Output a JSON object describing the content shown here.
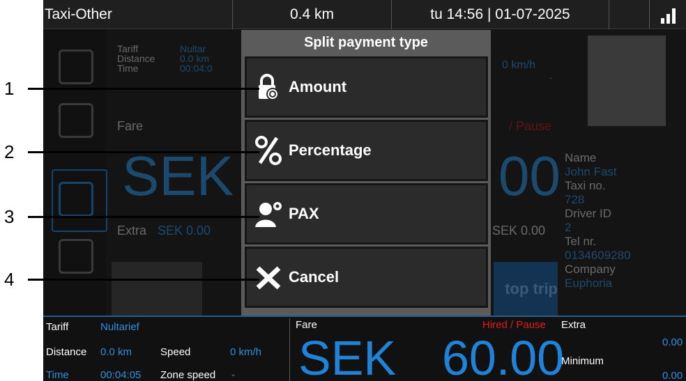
{
  "statusbar": {
    "title": "Taxi-Other",
    "distance": "0.4 km",
    "clock": "tu 14:56 | 01-07-2025"
  },
  "background": {
    "trip": {
      "tariff_label": "Tariff",
      "tariff_value": "Nultar",
      "distance_label": "Distance",
      "distance_value": "0.0 km",
      "time_label": "Time",
      "time_value": "00:04:0",
      "speed_value": "0 km/h",
      "zone_speed_value": "-",
      "fare_label": "Fare",
      "status": "/ Pause",
      "big_currency": "SEK",
      "big_value": "00",
      "extra_label": "Extra",
      "extra_value": "SEK 0.00",
      "extra_value_right": "SEK 0.00",
      "stop_trip": "top trip"
    },
    "profile": {
      "name_label": "Name",
      "name_value": "John Fast",
      "taxi_label": "Taxi no.",
      "taxi_value": "728",
      "driver_label": "Driver ID",
      "driver_value": "2",
      "tel_label": "Tel nr.",
      "tel_value": "0134609280",
      "company_label": "Company",
      "company_value": "Euphoria"
    }
  },
  "dialog": {
    "title": "Split payment type",
    "options": [
      {
        "label": "Amount",
        "icon": "lock-coin-icon"
      },
      {
        "label": "Percentage",
        "icon": "percent-icon"
      },
      {
        "label": "PAX",
        "icon": "passenger-icon"
      },
      {
        "label": "Cancel",
        "icon": "cancel-x-icon"
      }
    ]
  },
  "bottombar": {
    "tariff_label": "Tariff",
    "tariff_value": "Nultarief",
    "distance_label": "Distance",
    "distance_value": "0.0 km",
    "speed_label": "Speed",
    "speed_value": "0 km/h",
    "time_label": "Time",
    "time_value": "00:04:05",
    "zone_speed_label": "Zone speed",
    "zone_speed_value": "-",
    "fare_label": "Fare",
    "status": "Hired / Pause",
    "currency": "SEK",
    "fare_value": "60.00",
    "extra_label": "Extra",
    "extra_value": "0.00",
    "minimum_label": "Minimum",
    "minimum_value": "0.00"
  },
  "callouts": [
    "1",
    "2",
    "3",
    "4"
  ],
  "colors": {
    "accent_blue": "#1f84d9",
    "status_red": "#e21b1b",
    "dialog_bg": "#5b5b5b",
    "option_bg": "#2b2b2b"
  }
}
